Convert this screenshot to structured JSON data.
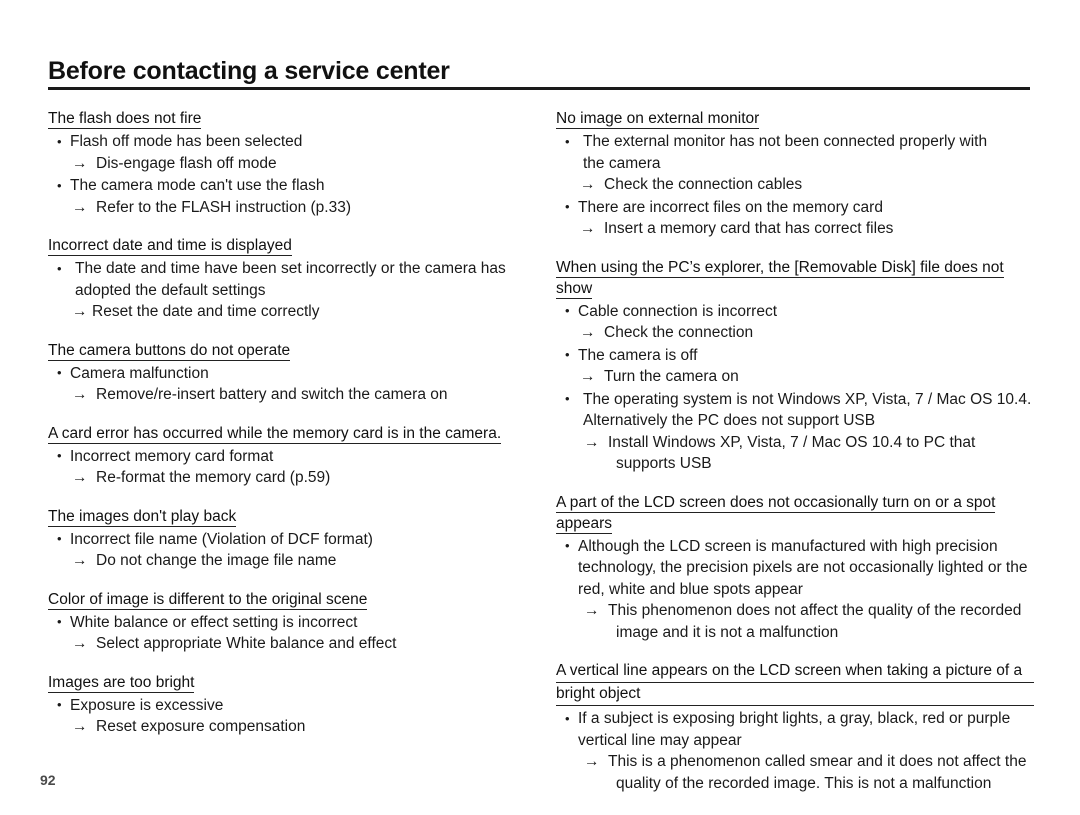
{
  "page": {
    "title": "Before contacting a service center",
    "page_number": "92"
  },
  "left_column": [
    {
      "heading": "The flash does not fire",
      "lines": [
        {
          "type": "bullet",
          "text": "Flash off mode has been selected"
        },
        {
          "type": "arrow",
          "text": "Dis-engage flash off mode"
        },
        {
          "type": "bullet",
          "text": "The camera mode can't use the flash"
        },
        {
          "type": "arrow",
          "text": "Refer to the FLASH instruction (p.33)"
        }
      ]
    },
    {
      "heading": "Incorrect date and time is displayed",
      "lines": [
        {
          "type": "bullet-gap",
          "text": "The date and time have been set incorrectly or the camera has"
        },
        {
          "type": "cont",
          "text": "adopted the default settings"
        },
        {
          "type": "arrow-tight",
          "text": "Reset the date and time correctly"
        }
      ]
    },
    {
      "heading": "The camera buttons do not operate",
      "lines": [
        {
          "type": "bullet",
          "text": "Camera malfunction"
        },
        {
          "type": "arrow",
          "text": "Remove/re-insert battery and switch the camera on"
        }
      ]
    },
    {
      "heading": "A card error has occurred while the memory card is in the camera.",
      "lines": [
        {
          "type": "bullet",
          "text": "Incorrect memory card format"
        },
        {
          "type": "arrow",
          "text": "Re-format the memory card (p.59)"
        }
      ]
    },
    {
      "heading": "The images don't play back",
      "lines": [
        {
          "type": "bullet",
          "text": "Incorrect file name (Violation of DCF format)"
        },
        {
          "type": "arrow",
          "text": "Do not change the image file name"
        }
      ]
    },
    {
      "heading": "Color of image is different to the original scene",
      "lines": [
        {
          "type": "bullet",
          "text": "White balance or effect setting is incorrect"
        },
        {
          "type": "arrow",
          "text": "Select appropriate White balance and effect"
        }
      ]
    },
    {
      "heading": "Images are too bright",
      "lines": [
        {
          "type": "bullet",
          "text": "Exposure is excessive"
        },
        {
          "type": "arrow",
          "text": "Reset exposure compensation"
        }
      ]
    }
  ],
  "right_column": [
    {
      "heading": "No image on external monitor",
      "lines": [
        {
          "type": "bullet-gap",
          "text": "The external monitor has not been connected properly with"
        },
        {
          "type": "cont",
          "text": "the camera"
        },
        {
          "type": "arrow",
          "text": "Check the connection cables"
        },
        {
          "type": "bullet",
          "text": "There are incorrect files on the memory card"
        },
        {
          "type": "arrow",
          "text": "Insert a memory card that has correct files"
        }
      ]
    },
    {
      "heading": "When using the PC’s explorer, the [Removable Disk] file does not show",
      "lines": [
        {
          "type": "bullet",
          "text": "Cable connection is incorrect"
        },
        {
          "type": "arrow",
          "text": "Check the connection"
        },
        {
          "type": "bullet",
          "text": "The camera is off"
        },
        {
          "type": "arrow",
          "text": "Turn the camera on"
        },
        {
          "type": "bullet-gap",
          "text": "The operating system is not Windows XP, Vista, 7 / Mac OS 10.4."
        },
        {
          "type": "cont",
          "text": "Alternatively the PC does not support USB"
        },
        {
          "type": "arrow-deep",
          "text": "Install Windows XP, Vista, 7 / Mac OS 10.4 to PC that"
        },
        {
          "type": "cont-deeper",
          "text": "supports USB"
        }
      ]
    },
    {
      "heading": "A part of the LCD screen does not occasionally turn on or a spot appears",
      "lines": [
        {
          "type": "bullet",
          "text": "Although the LCD screen is manufactured with high precision"
        },
        {
          "type": "cont-tight",
          "text": "technology, the precision pixels are not occasionally lighted or the"
        },
        {
          "type": "cont-tight",
          "text": "red, white and blue spots appear"
        },
        {
          "type": "arrow-deep",
          "text": "This phenomenon does not affect the quality of the recorded"
        },
        {
          "type": "cont-deeper",
          "text": "image and it is not a malfunction"
        }
      ]
    },
    {
      "heading": "A vertical line appears on the LCD screen when taking a picture of a bright object",
      "heading_wrap": true,
      "heading_lines": [
        "A vertical line appears on the LCD screen when taking a picture of a",
        "bright object"
      ],
      "lines": [
        {
          "type": "bullet",
          "text": "If a subject is exposing bright lights, a gray, black, red or purple"
        },
        {
          "type": "cont-tight",
          "text": "vertical line may appear"
        },
        {
          "type": "arrow-deep",
          "text": "This is a phenomenon called smear and it does not affect the"
        },
        {
          "type": "cont-deeper",
          "text": "quality of the recorded image. This is not a malfunction"
        }
      ]
    }
  ]
}
